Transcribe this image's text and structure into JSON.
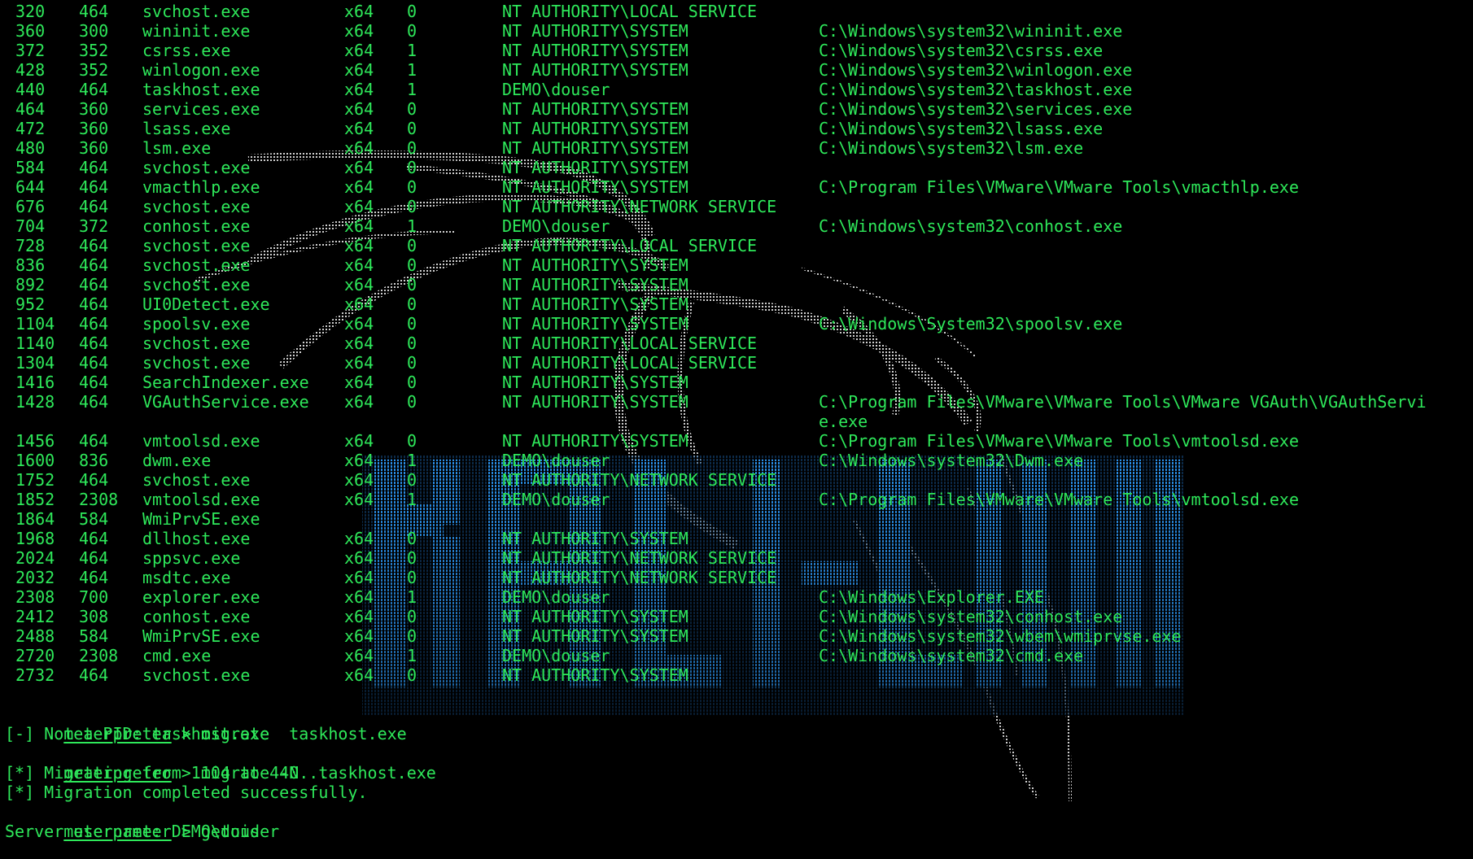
{
  "process_table": [
    {
      "pid": "320",
      "ppid": "464",
      "name": "svchost.exe",
      "arch": "x64",
      "session": "0",
      "user": "NT AUTHORITY\\LOCAL SERVICE",
      "path": ""
    },
    {
      "pid": "360",
      "ppid": "300",
      "name": "wininit.exe",
      "arch": "x64",
      "session": "0",
      "user": "NT AUTHORITY\\SYSTEM",
      "path": "C:\\Windows\\system32\\wininit.exe"
    },
    {
      "pid": "372",
      "ppid": "352",
      "name": "csrss.exe",
      "arch": "x64",
      "session": "1",
      "user": "NT AUTHORITY\\SYSTEM",
      "path": "C:\\Windows\\system32\\csrss.exe"
    },
    {
      "pid": "428",
      "ppid": "352",
      "name": "winlogon.exe",
      "arch": "x64",
      "session": "1",
      "user": "NT AUTHORITY\\SYSTEM",
      "path": "C:\\Windows\\system32\\winlogon.exe"
    },
    {
      "pid": "440",
      "ppid": "464",
      "name": "taskhost.exe",
      "arch": "x64",
      "session": "1",
      "user": "DEMO\\douser",
      "path": "C:\\Windows\\system32\\taskhost.exe"
    },
    {
      "pid": "464",
      "ppid": "360",
      "name": "services.exe",
      "arch": "x64",
      "session": "0",
      "user": "NT AUTHORITY\\SYSTEM",
      "path": "C:\\Windows\\system32\\services.exe"
    },
    {
      "pid": "472",
      "ppid": "360",
      "name": "lsass.exe",
      "arch": "x64",
      "session": "0",
      "user": "NT AUTHORITY\\SYSTEM",
      "path": "C:\\Windows\\system32\\lsass.exe"
    },
    {
      "pid": "480",
      "ppid": "360",
      "name": "lsm.exe",
      "arch": "x64",
      "session": "0",
      "user": "NT AUTHORITY\\SYSTEM",
      "path": "C:\\Windows\\system32\\lsm.exe"
    },
    {
      "pid": "584",
      "ppid": "464",
      "name": "svchost.exe",
      "arch": "x64",
      "session": "0",
      "user": "NT AUTHORITY\\SYSTEM",
      "path": ""
    },
    {
      "pid": "644",
      "ppid": "464",
      "name": "vmacthlp.exe",
      "arch": "x64",
      "session": "0",
      "user": "NT AUTHORITY\\SYSTEM",
      "path": "C:\\Program Files\\VMware\\VMware Tools\\vmacthlp.exe"
    },
    {
      "pid": "676",
      "ppid": "464",
      "name": "svchost.exe",
      "arch": "x64",
      "session": "0",
      "user": "NT AUTHORITY\\NETWORK SERVICE",
      "path": ""
    },
    {
      "pid": "704",
      "ppid": "372",
      "name": "conhost.exe",
      "arch": "x64",
      "session": "1",
      "user": "DEMO\\douser",
      "path": "C:\\Windows\\system32\\conhost.exe"
    },
    {
      "pid": "728",
      "ppid": "464",
      "name": "svchost.exe",
      "arch": "x64",
      "session": "0",
      "user": "NT AUTHORITY\\LOCAL SERVICE",
      "path": ""
    },
    {
      "pid": "836",
      "ppid": "464",
      "name": "svchost.exe",
      "arch": "x64",
      "session": "0",
      "user": "NT AUTHORITY\\SYSTEM",
      "path": ""
    },
    {
      "pid": "892",
      "ppid": "464",
      "name": "svchost.exe",
      "arch": "x64",
      "session": "0",
      "user": "NT AUTHORITY\\SYSTEM",
      "path": ""
    },
    {
      "pid": "952",
      "ppid": "464",
      "name": "UI0Detect.exe",
      "arch": "x64",
      "session": "0",
      "user": "NT AUTHORITY\\SYSTEM",
      "path": ""
    },
    {
      "pid": "1104",
      "ppid": "464",
      "name": "spoolsv.exe",
      "arch": "x64",
      "session": "0",
      "user": "NT AUTHORITY\\SYSTEM",
      "path": "C:\\Windows\\System32\\spoolsv.exe"
    },
    {
      "pid": "1140",
      "ppid": "464",
      "name": "svchost.exe",
      "arch": "x64",
      "session": "0",
      "user": "NT AUTHORITY\\LOCAL SERVICE",
      "path": ""
    },
    {
      "pid": "1304",
      "ppid": "464",
      "name": "svchost.exe",
      "arch": "x64",
      "session": "0",
      "user": "NT AUTHORITY\\LOCAL SERVICE",
      "path": ""
    },
    {
      "pid": "1416",
      "ppid": "464",
      "name": "SearchIndexer.exe",
      "arch": "x64",
      "session": "0",
      "user": "NT AUTHORITY\\SYSTEM",
      "path": ""
    },
    {
      "pid": "1428",
      "ppid": "464",
      "name": "VGAuthService.exe",
      "arch": "x64",
      "session": "0",
      "user": "NT AUTHORITY\\SYSTEM",
      "path": "C:\\Program Files\\VMware\\VMware Tools\\VMware VGAuth\\VGAuthServi",
      "path_wrap": "e.exe"
    },
    {
      "pid": "1456",
      "ppid": "464",
      "name": "vmtoolsd.exe",
      "arch": "x64",
      "session": "0",
      "user": "NT AUTHORITY\\SYSTEM",
      "path": "C:\\Program Files\\VMware\\VMware Tools\\vmtoolsd.exe"
    },
    {
      "pid": "1600",
      "ppid": "836",
      "name": "dwm.exe",
      "arch": "x64",
      "session": "1",
      "user": "DEMO\\douser",
      "path": "C:\\Windows\\system32\\Dwm.exe"
    },
    {
      "pid": "1752",
      "ppid": "464",
      "name": "svchost.exe",
      "arch": "x64",
      "session": "0",
      "user": "NT AUTHORITY\\NETWORK SERVICE",
      "path": ""
    },
    {
      "pid": "1852",
      "ppid": "2308",
      "name": "vmtoolsd.exe",
      "arch": "x64",
      "session": "1",
      "user": "DEMO\\douser",
      "path": "C:\\Program Files\\VMware\\VMware Tools\\vmtoolsd.exe"
    },
    {
      "pid": "1864",
      "ppid": "584",
      "name": "WmiPrvSE.exe",
      "arch": "",
      "session": "",
      "user": "",
      "path": ""
    },
    {
      "pid": "1968",
      "ppid": "464",
      "name": "dllhost.exe",
      "arch": "x64",
      "session": "0",
      "user": "NT AUTHORITY\\SYSTEM",
      "path": ""
    },
    {
      "pid": "2024",
      "ppid": "464",
      "name": "sppsvc.exe",
      "arch": "x64",
      "session": "0",
      "user": "NT AUTHORITY\\NETWORK SERVICE",
      "path": ""
    },
    {
      "pid": "2032",
      "ppid": "464",
      "name": "msdtc.exe",
      "arch": "x64",
      "session": "0",
      "user": "NT AUTHORITY\\NETWORK SERVICE",
      "path": ""
    },
    {
      "pid": "2308",
      "ppid": "700",
      "name": "explorer.exe",
      "arch": "x64",
      "session": "1",
      "user": "DEMO\\douser",
      "path": "C:\\Windows\\Explorer.EXE"
    },
    {
      "pid": "2412",
      "ppid": "308",
      "name": "conhost.exe",
      "arch": "x64",
      "session": "0",
      "user": "NT AUTHORITY\\SYSTEM",
      "path": "C:\\Windows\\system32\\conhost.exe"
    },
    {
      "pid": "2488",
      "ppid": "584",
      "name": "WmiPrvSE.exe",
      "arch": "x64",
      "session": "0",
      "user": "NT AUTHORITY\\SYSTEM",
      "path": "C:\\Windows\\system32\\wbem\\wmiprvse.exe"
    },
    {
      "pid": "2720",
      "ppid": "2308",
      "name": "cmd.exe",
      "arch": "x64",
      "session": "1",
      "user": "DEMO\\douser",
      "path": "C:\\Windows\\system32\\cmd.exe"
    },
    {
      "pid": "2732",
      "ppid": "464",
      "name": "svchost.exe",
      "arch": "x64",
      "session": "0",
      "user": "NT AUTHORITY\\SYSTEM",
      "path": ""
    }
  ],
  "session": {
    "prompt_word": "meterpreter",
    "prompt_suffix": " > ",
    "cmd1": "migrate  taskhost.exe",
    "out1": "[-] Not a PID: taskhost.exe",
    "cmd2": "migrate -N  taskhost.exe",
    "out2": "[*] Migrating from 1104 to 440...",
    "out3": "[*] Migration completed successfully.",
    "cmd3": "getuid",
    "out4": "Server username: DEMO\\douser",
    "cmd4": ""
  },
  "colors": {
    "background": "#000000",
    "text": "#2ee85a",
    "wallpaper_dragon": "#d8d8d8",
    "wallpaper_logo": "#1e7fd0"
  }
}
